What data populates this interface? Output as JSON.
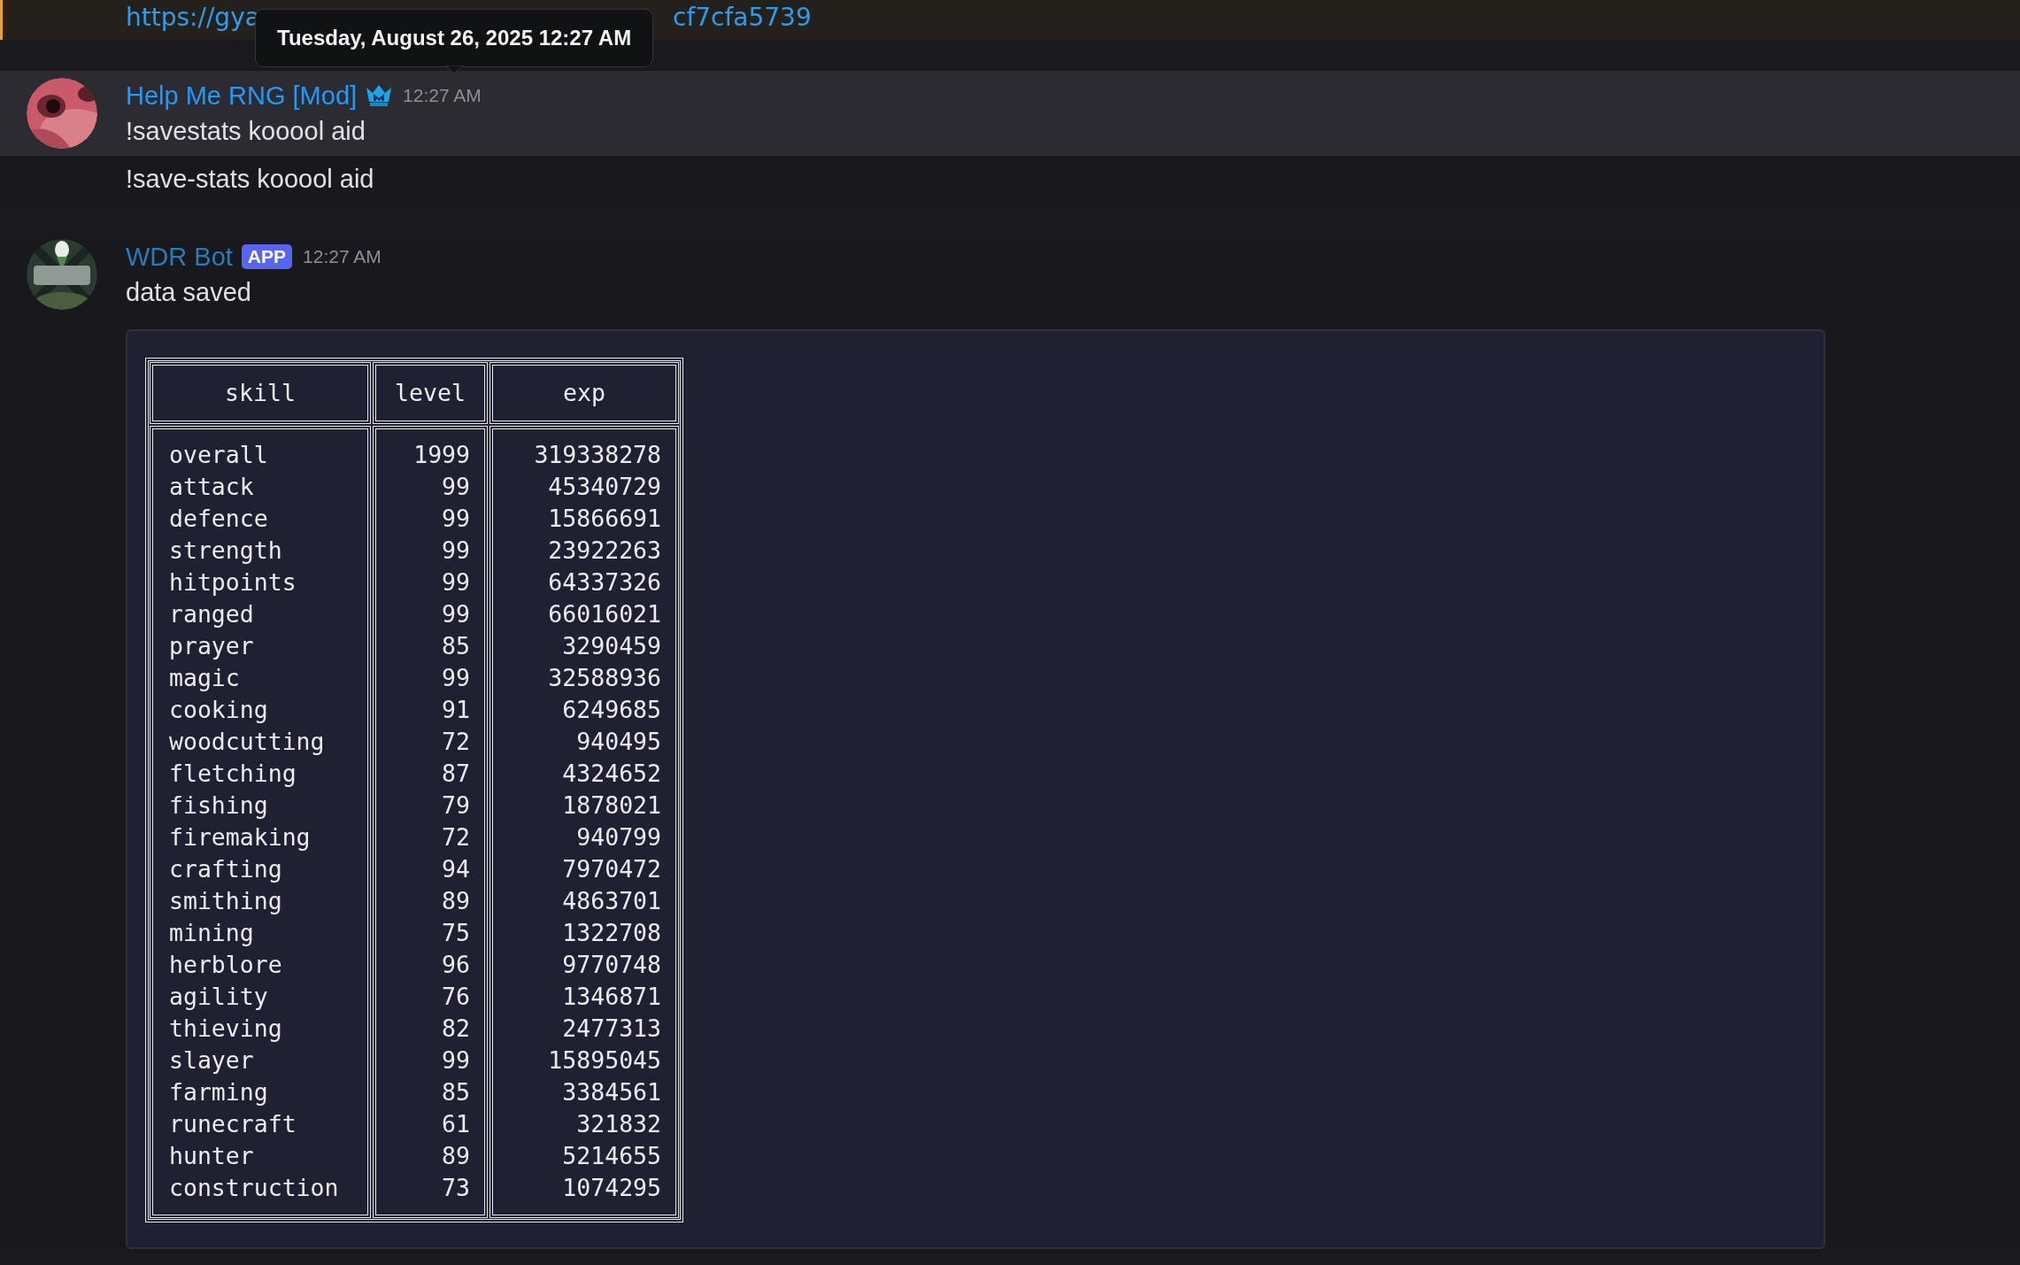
{
  "link": {
    "start": "https://gya",
    "end": "cf7cfa5739"
  },
  "tooltip": "Tuesday, August 26, 2025 12:27 AM",
  "messages": [
    {
      "kind": "moderator",
      "highlighted": true,
      "author": "Help Me RNG [Mod]",
      "color": "#1e9bff",
      "time": "12:27 AM",
      "text": "!savestats kooool aid"
    },
    {
      "kind": "followup",
      "highlighted": false,
      "text": "!save-stats kooool aid"
    },
    {
      "kind": "bot",
      "highlighted": false,
      "author": "WDR Bot",
      "color": "#2a7ab8",
      "tag": "APP",
      "time": "12:27 AM",
      "text": "data saved",
      "table": {
        "columns": [
          "skill",
          "level",
          "exp"
        ],
        "rows": [
          [
            "overall",
            "1999",
            "319338278"
          ],
          [
            "attack",
            "99",
            "45340729"
          ],
          [
            "defence",
            "99",
            "15866691"
          ],
          [
            "strength",
            "99",
            "23922263"
          ],
          [
            "hitpoints",
            "99",
            "64337326"
          ],
          [
            "ranged",
            "99",
            "66016021"
          ],
          [
            "prayer",
            "85",
            "3290459"
          ],
          [
            "magic",
            "99",
            "32588936"
          ],
          [
            "cooking",
            "91",
            "6249685"
          ],
          [
            "woodcutting",
            "72",
            "940495"
          ],
          [
            "fletching",
            "87",
            "4324652"
          ],
          [
            "fishing",
            "79",
            "1878021"
          ],
          [
            "firemaking",
            "72",
            "940799"
          ],
          [
            "crafting",
            "94",
            "7970472"
          ],
          [
            "smithing",
            "89",
            "4863701"
          ],
          [
            "mining",
            "75",
            "1322708"
          ],
          [
            "herblore",
            "96",
            "9770748"
          ],
          [
            "agility",
            "76",
            "1346871"
          ],
          [
            "thieving",
            "82",
            "2477313"
          ],
          [
            "slayer",
            "99",
            "15895045"
          ],
          [
            "farming",
            "85",
            "3384561"
          ],
          [
            "runecraft",
            "61",
            "321832"
          ],
          [
            "hunter",
            "89",
            "5214655"
          ],
          [
            "construction",
            "73",
            "1074295"
          ]
        ]
      }
    }
  ]
}
